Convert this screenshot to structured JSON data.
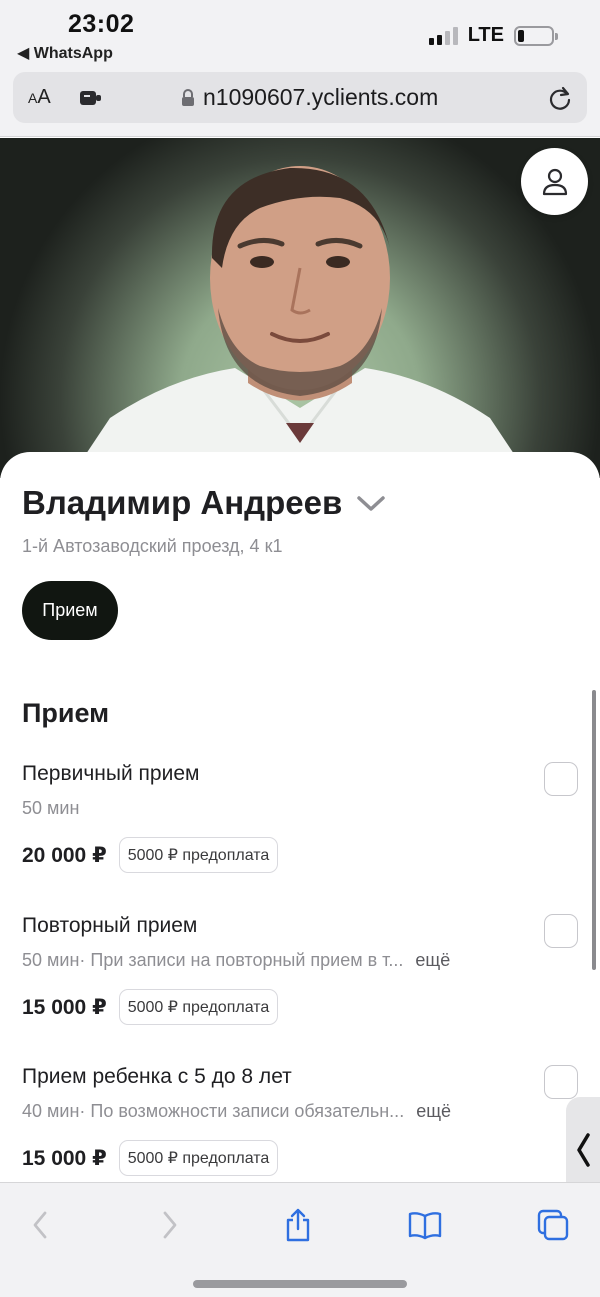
{
  "status_bar": {
    "time": "23:02",
    "back_app": "◀ WhatsApp",
    "network": "LTE"
  },
  "browser": {
    "text_size_label": "AA",
    "url": "n1090607.yclients.com"
  },
  "profile": {
    "name": "Владимир Андреев",
    "address": "1-й Автозаводский проезд, 4 к1",
    "category_pill": "Прием"
  },
  "section": {
    "title": "Прием"
  },
  "services": [
    {
      "title": "Первичный прием",
      "duration": "50 мин",
      "description": "",
      "more": "",
      "price": "20 000 ₽",
      "prepay": "5000 ₽ предоплата"
    },
    {
      "title": "Повторный прием",
      "duration": "50 мин",
      "description": " · При записи на повторный прием в т...",
      "more": "ещё",
      "price": "15 000 ₽",
      "prepay": "5000 ₽ предоплата"
    },
    {
      "title": "Прием ребенка с 5 до 8 лет",
      "duration": "40 мин",
      "description": " · По возможности записи обязательн...",
      "more": "ещё",
      "price": "15 000 ₽",
      "prepay": "5000 ₽ предоплата"
    }
  ],
  "icons": {
    "profile": "person-icon",
    "lock": "lock-icon",
    "reload": "reload-icon",
    "back": "chevron-left-icon",
    "forward": "chevron-right-icon",
    "share": "share-icon",
    "bookmarks": "book-icon",
    "tabs": "tabs-icon",
    "handle": "chevron-left-icon"
  },
  "colors": {
    "pill_bg": "#111611",
    "accent": "#2f6fe0"
  }
}
